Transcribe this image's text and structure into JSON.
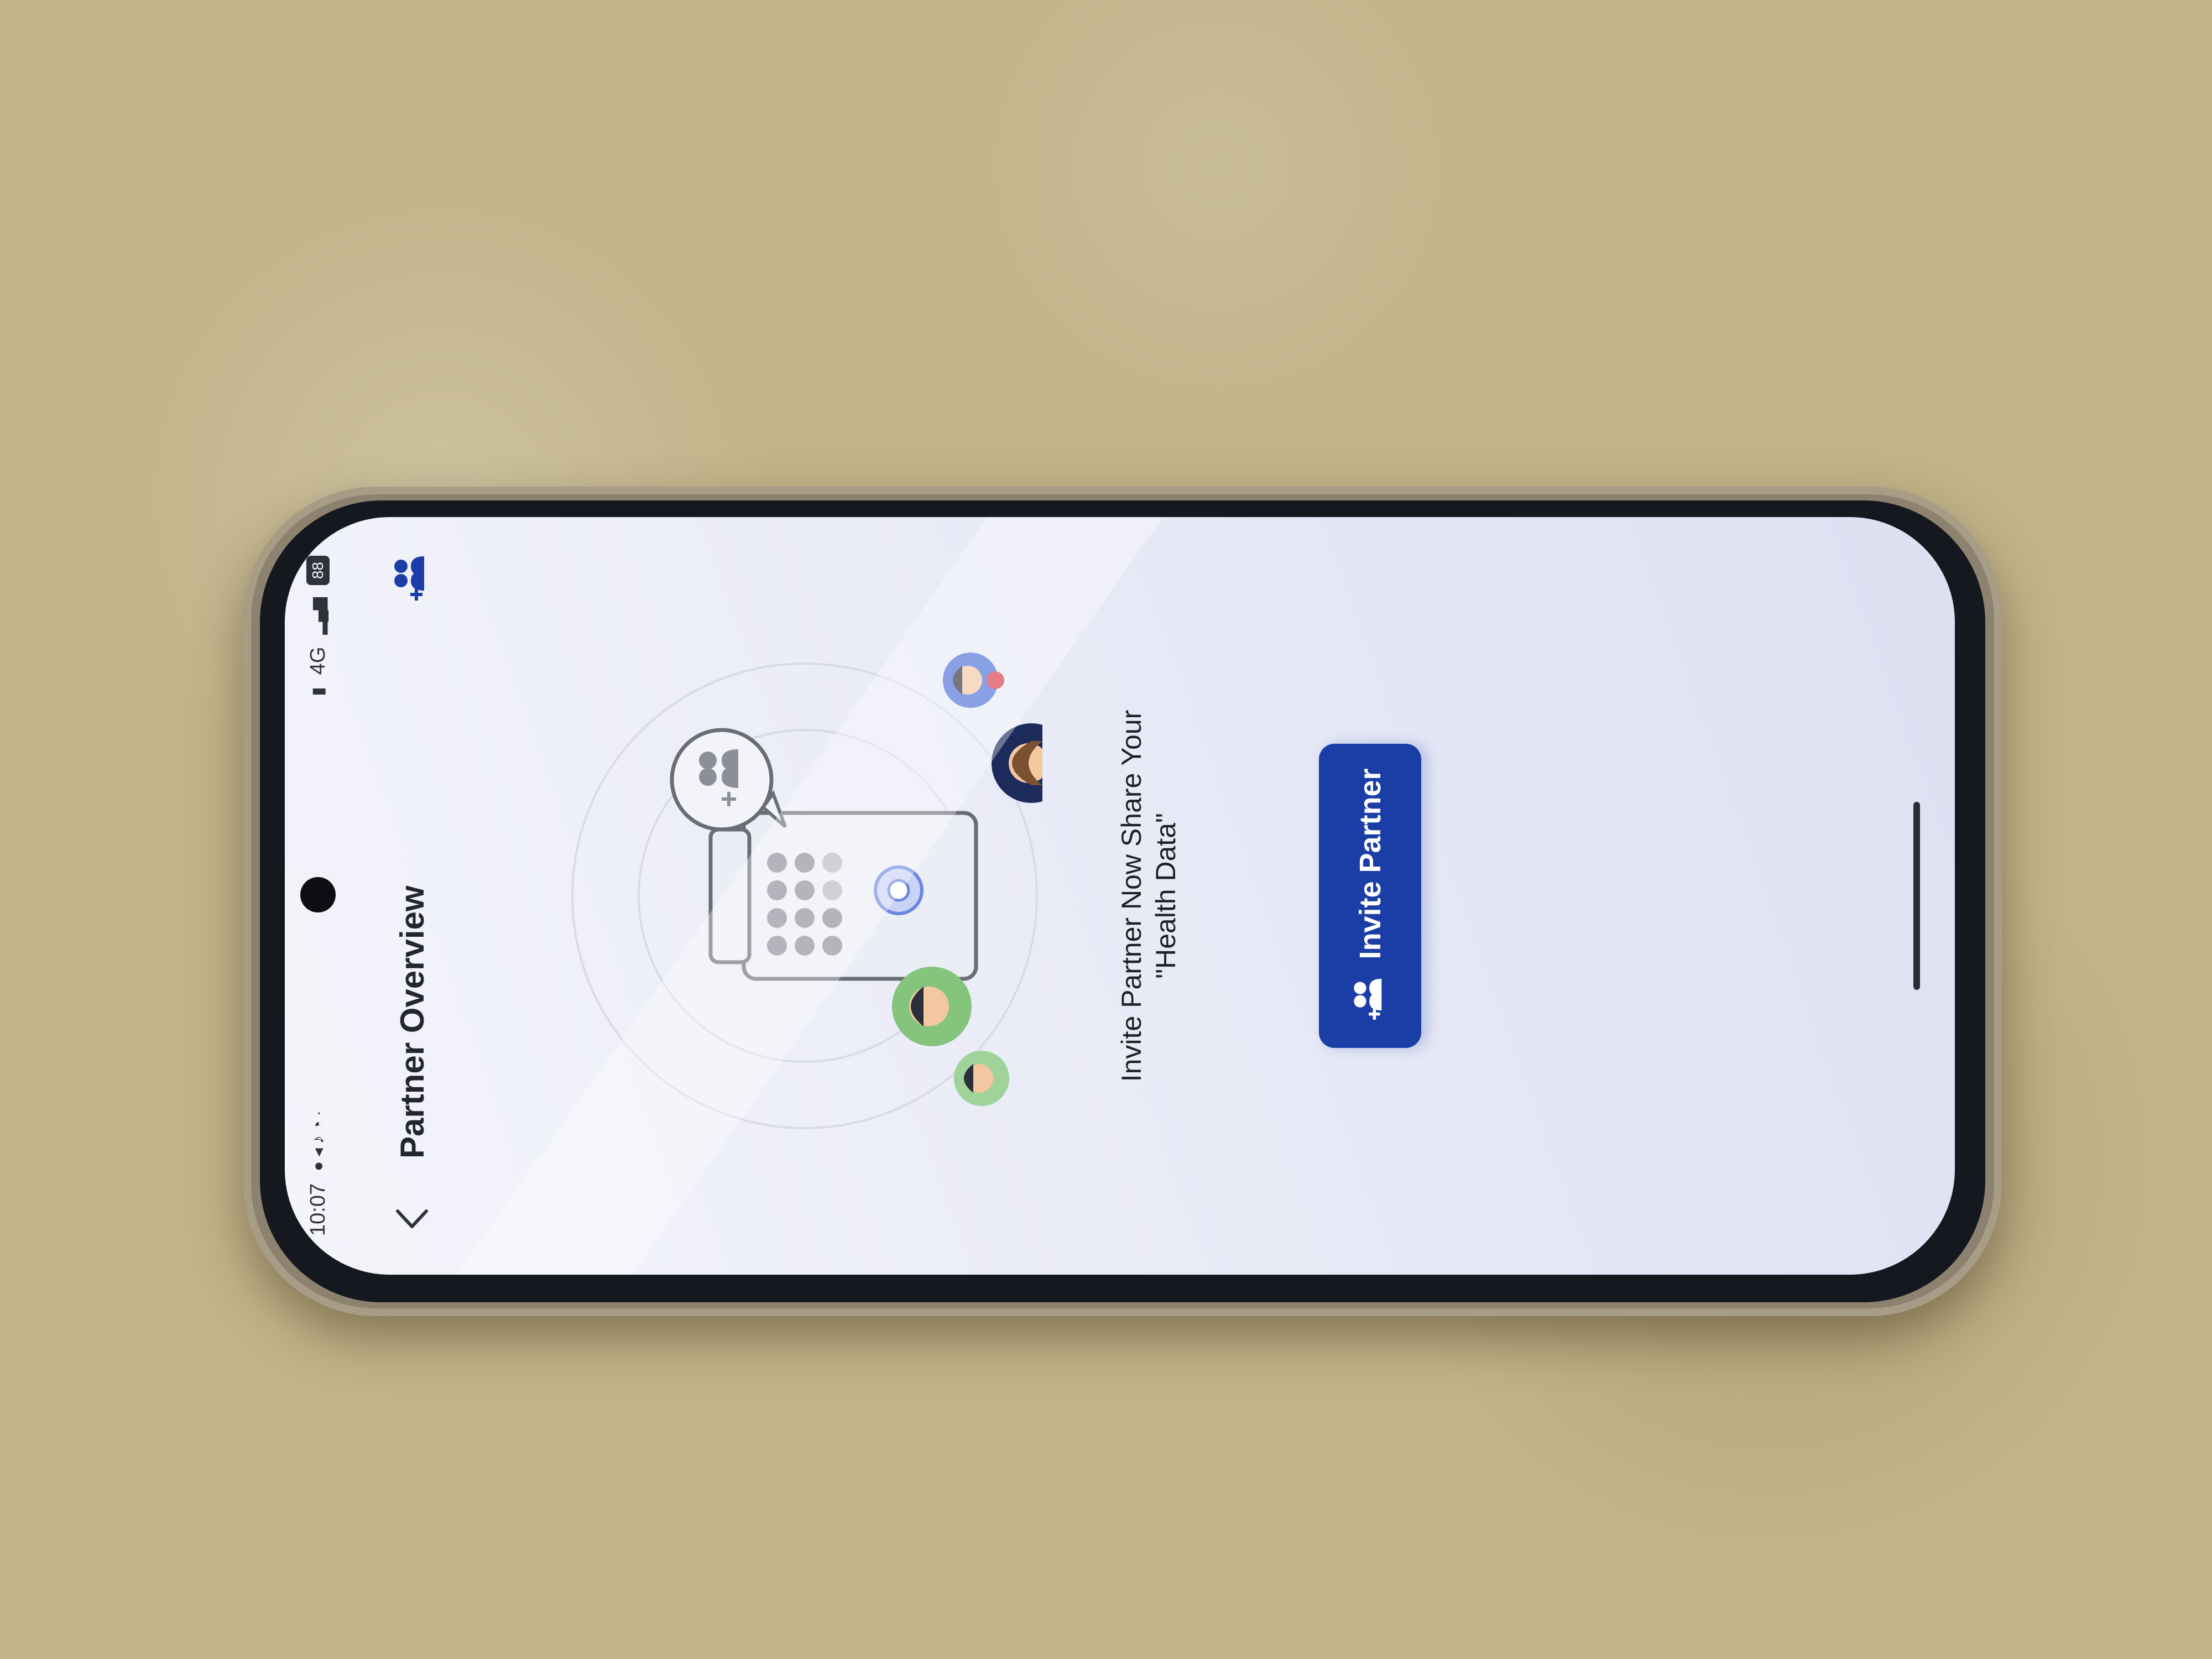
{
  "status_bar": {
    "time": "10:07",
    "network": "4G",
    "battery": "88"
  },
  "header": {
    "back_icon": "chevron-left-icon",
    "title": "Partner Overview",
    "action_icon": "add-people-icon"
  },
  "main": {
    "message_line1": "Invite Partner Now Share Your",
    "message_line2": "\"Health Data\"",
    "invite_button_label": "Invite Partner",
    "invite_button_icon": "add-people-icon"
  },
  "colors": {
    "accent": "#1a3ea6",
    "background": "#eef0f8"
  }
}
